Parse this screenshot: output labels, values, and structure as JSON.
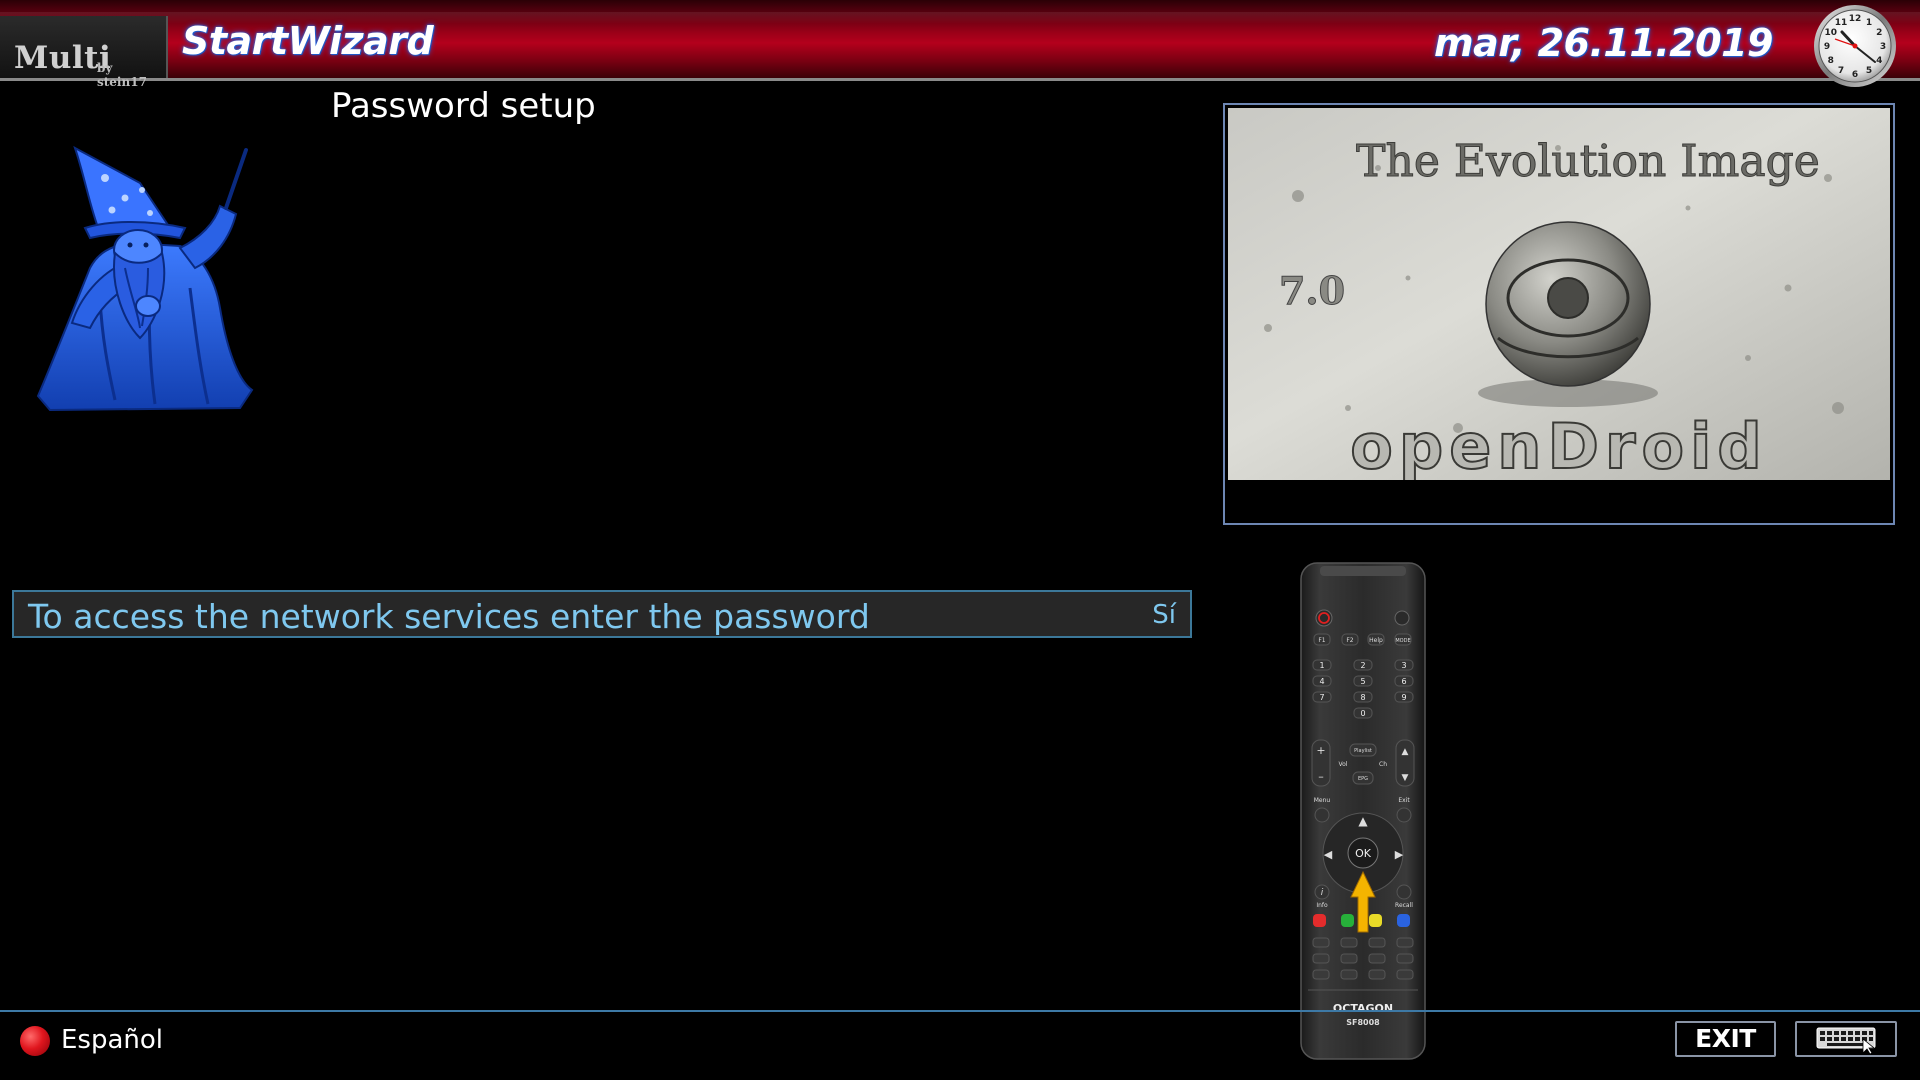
{
  "header": {
    "brand": "Multi",
    "brand_by": "by stein17",
    "title": "StartWizard",
    "date": "mar, 26.11.2019"
  },
  "clock": {
    "numbers": [
      "12",
      "1",
      "2",
      "3",
      "4",
      "5",
      "6",
      "7",
      "8",
      "9",
      "10",
      "11"
    ]
  },
  "main": {
    "subtitle": "Password setup",
    "config_items": [
      {
        "label": "To access the network services enter the password",
        "value": "Sí"
      }
    ]
  },
  "preview": {
    "heading": "The Evolution Image",
    "version": "7.0",
    "logo_text": "openDroid"
  },
  "remote": {
    "brand": "OCTAGON",
    "model": "SF8008",
    "ok_label": "OK",
    "buttons": {
      "f1": "F1",
      "f2": "F2",
      "help": "Help",
      "mode": "MODE",
      "vol": "Vol",
      "ch": "Ch",
      "playlist": "Playlist",
      "epg": "EPG",
      "menu": "Menu",
      "exit": "Exit",
      "info": "Info",
      "recall": "Recall"
    },
    "digits": [
      "1",
      "2",
      "3",
      "4",
      "5",
      "6",
      "7",
      "8",
      "9",
      "0"
    ]
  },
  "footer": {
    "language": "Español",
    "exit_label": "EXIT"
  },
  "colors": {
    "header_red": "#b4001c",
    "selection_text": "#7fc8ef",
    "selection_border": "#3c7899",
    "wizard_blue": "#2f6bff",
    "red_button": "#e0161e"
  },
  "icons": {
    "wizard": "wizard-mascot-icon",
    "clock": "analog-clock-icon",
    "keyboard": "keyboard-icon",
    "language_dot": "red-button-icon"
  }
}
